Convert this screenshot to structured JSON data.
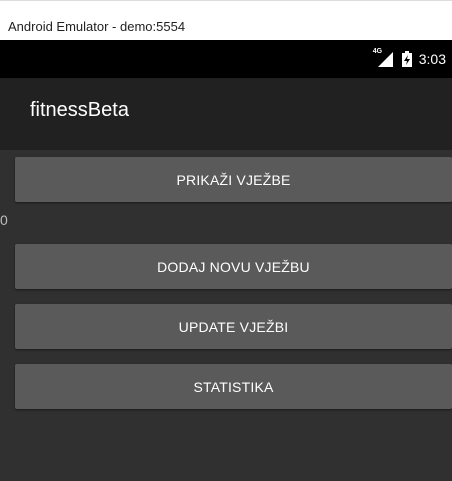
{
  "window": {
    "title": "Android Emulator - demo:5554"
  },
  "status_bar": {
    "network": "4G",
    "time": "3:03",
    "icons": [
      "signal-icon",
      "battery-icon"
    ]
  },
  "action_bar": {
    "title": "fitnessBeta"
  },
  "main": {
    "buttons": [
      {
        "label": "PRIKAŽI VJEŽBE"
      },
      {
        "label": "DODAJ NOVU VJEŽBU"
      },
      {
        "label": "UPDATE VJEŽBI"
      },
      {
        "label": "STATISTIKA"
      }
    ],
    "count_text": "0"
  },
  "colors": {
    "background": "#303030",
    "action_bar": "#212121",
    "status_bar": "#000000",
    "button": "#5a5a5a",
    "text": "#ffffff"
  }
}
